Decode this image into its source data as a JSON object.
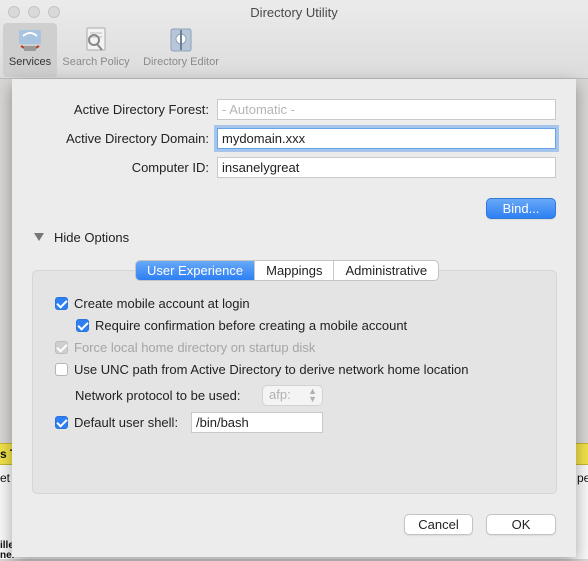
{
  "window": {
    "title": "Directory Utility",
    "toolbar": [
      {
        "label": "Services",
        "icon": "services-icon",
        "active": true
      },
      {
        "label": "Search Policy",
        "icon": "search-policy-icon",
        "active": false
      },
      {
        "label": "Directory Editor",
        "icon": "directory-editor-icon",
        "active": false
      }
    ]
  },
  "form": {
    "forest_label": "Active Directory Forest:",
    "forest_placeholder": "- Automatic -",
    "domain_label": "Active Directory Domain:",
    "domain_value": "mydomain.xxx",
    "computer_id_label": "Computer ID:",
    "computer_id_value": "insanelygreat",
    "bind_button": "Bind..."
  },
  "options": {
    "toggle_label": "Hide Options",
    "tabs": [
      "User Experience",
      "Mappings",
      "Administrative"
    ],
    "selected_tab": "User Experience",
    "mobile_account": {
      "label": "Create mobile account at login",
      "checked": true
    },
    "require_confirmation": {
      "label": "Require confirmation before creating a mobile account",
      "checked": true
    },
    "force_local_home": {
      "label": "Force local home directory on startup disk",
      "checked": true,
      "disabled": true
    },
    "use_unc": {
      "label": "Use UNC path from Active Directory to derive network home location",
      "checked": false
    },
    "network_protocol_label": "Network protocol to be used:",
    "network_protocol_value": "afp:",
    "default_shell": {
      "label": "Default user shell:",
      "checked": true,
      "value": "/bin/bash"
    }
  },
  "footer": {
    "cancel": "Cancel",
    "ok": "OK"
  },
  "background_fragments": [
    "s T",
    "et",
    "ille",
    "ner",
    "pe"
  ],
  "colors": {
    "accent": "#2d7ff3",
    "background_strip": "#f2e34a"
  }
}
